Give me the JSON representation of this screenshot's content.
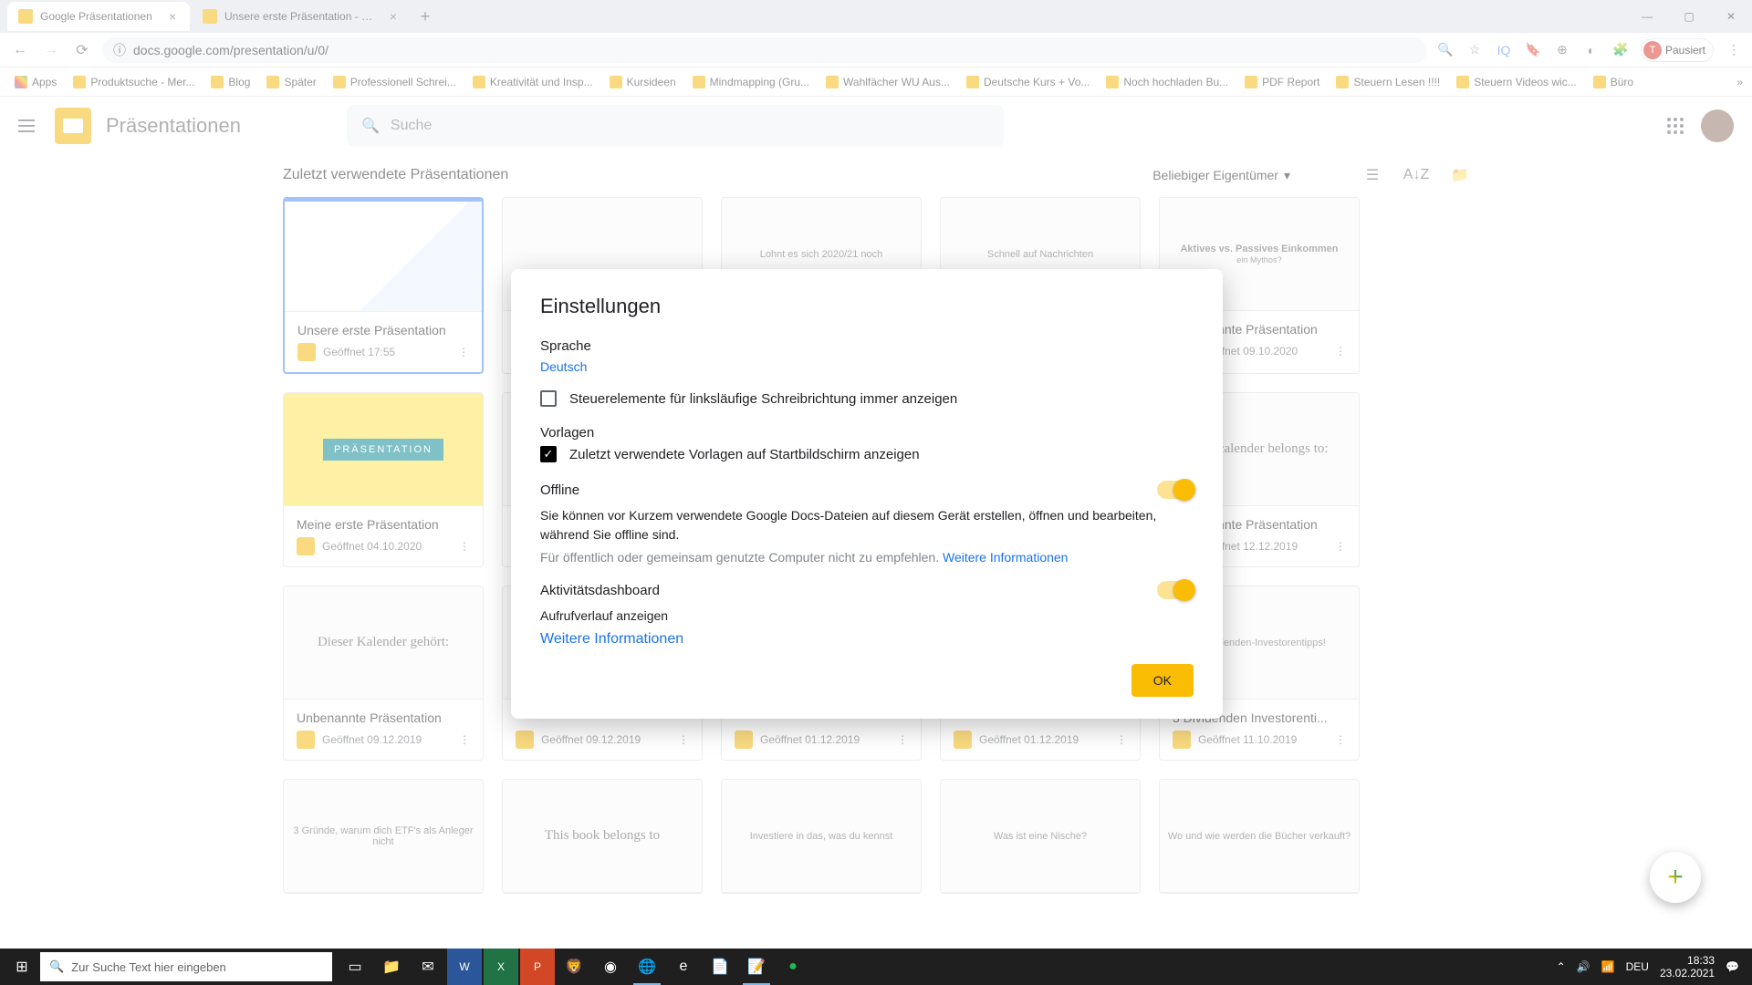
{
  "browser": {
    "tabs": [
      {
        "title": "Google Präsentationen"
      },
      {
        "title": "Unsere erste Präsentation - Goo..."
      }
    ],
    "url": "docs.google.com/presentation/u/0/",
    "profile_status": "Pausiert",
    "profile_initial": "T"
  },
  "bookmarks": [
    "Apps",
    "Produktsuche - Mer...",
    "Blog",
    "Später",
    "Professionell Schrei...",
    "Kreativität und Insp...",
    "Kursideen",
    "Mindmapping (Gru...",
    "Wahlfächer WU Aus...",
    "Deutsche Kurs + Vo...",
    "Noch hochladen Bu...",
    "PDF Report",
    "Steuern Lesen !!!!",
    "Steuern Videos wic...",
    "Büro"
  ],
  "app": {
    "title": "Präsentationen",
    "search_placeholder": "Suche"
  },
  "toolbar": {
    "section_title": "Zuletzt verwendete Präsentationen",
    "owner_filter": "Beliebiger Eigentümer"
  },
  "cards": [
    {
      "title": "Unsere erste Präsentation",
      "meta": "Geöffnet 17:55"
    },
    {
      "title": "",
      "meta": ""
    },
    {
      "title": "Lohnt es sich 2020/21 noch",
      "meta": ""
    },
    {
      "title": "Schnell auf Nachrichten",
      "meta": ""
    },
    {
      "title": "Aktives vs. Passives Einkommen",
      "meta": "",
      "sub": "ein Mythos?"
    },
    {
      "title": "Unbenannte Präsentation",
      "meta": "Geöffnet 09.10.2020"
    },
    {
      "title": "Meine erste Präsentation",
      "meta": "Geöffnet 04.10.2020"
    },
    {
      "title": "",
      "meta": ""
    },
    {
      "title": "",
      "meta": ""
    },
    {
      "title": "",
      "meta": ""
    },
    {
      "title": "This calender belongs to:",
      "meta": ""
    },
    {
      "title": "Unbenannte Präsentation",
      "meta": "Geöffnet 12.12.2019"
    },
    {
      "title": "Dieser Kalender gehört:",
      "meta": ""
    },
    {
      "title": "Unbenannte Präsentation",
      "meta": "Geöffnet 09.12.2019"
    },
    {
      "title": "",
      "meta": "Geöffnet 09.12.2019"
    },
    {
      "title": "",
      "meta": "Geöffnet 01.12.2019"
    },
    {
      "title": "",
      "meta": "Geöffnet 01.12.2019"
    },
    {
      "title": "3 Dividenden-Investorentipps!",
      "meta": ""
    },
    {
      "title": "3 Dividenden Investorenti...",
      "meta": "Geöffnet 11.10.2019"
    },
    {
      "title": "3 Gründe, warum dich ETF's als Anleger nicht",
      "meta": ""
    },
    {
      "title": "This book belongs to",
      "meta": ""
    },
    {
      "title": "Investiere in das, was du kennst",
      "meta": ""
    },
    {
      "title": "Was ist eine Nische?",
      "meta": ""
    },
    {
      "title": "Wo und wie werden die Bücher verkauft?",
      "meta": ""
    }
  ],
  "modal": {
    "title": "Einstellungen",
    "lang_label": "Sprache",
    "lang_value": "Deutsch",
    "rtl_label": "Steuerelemente für linksläufige Schreibrichtung immer anzeigen",
    "templates_label": "Vorlagen",
    "templates_check": "Zuletzt verwendete Vorlagen auf Startbildschirm anzeigen",
    "offline_label": "Offline",
    "offline_desc": "Sie können vor Kurzem verwendete Google Docs-Dateien auf diesem Gerät erstellen, öffnen und bearbeiten, während Sie offline sind.",
    "offline_warn": "Für öffentlich oder gemeinsam genutzte Computer nicht zu empfehlen. ",
    "more_info": "Weitere Informationen",
    "activity_label": "Aktivitätsdashboard",
    "activity_desc": "Aufrufverlauf anzeigen",
    "ok": "OK"
  },
  "taskbar": {
    "search_placeholder": "Zur Suche Text hier eingeben",
    "lang": "DEU",
    "time": "18:33",
    "date": "23.02.2021"
  }
}
